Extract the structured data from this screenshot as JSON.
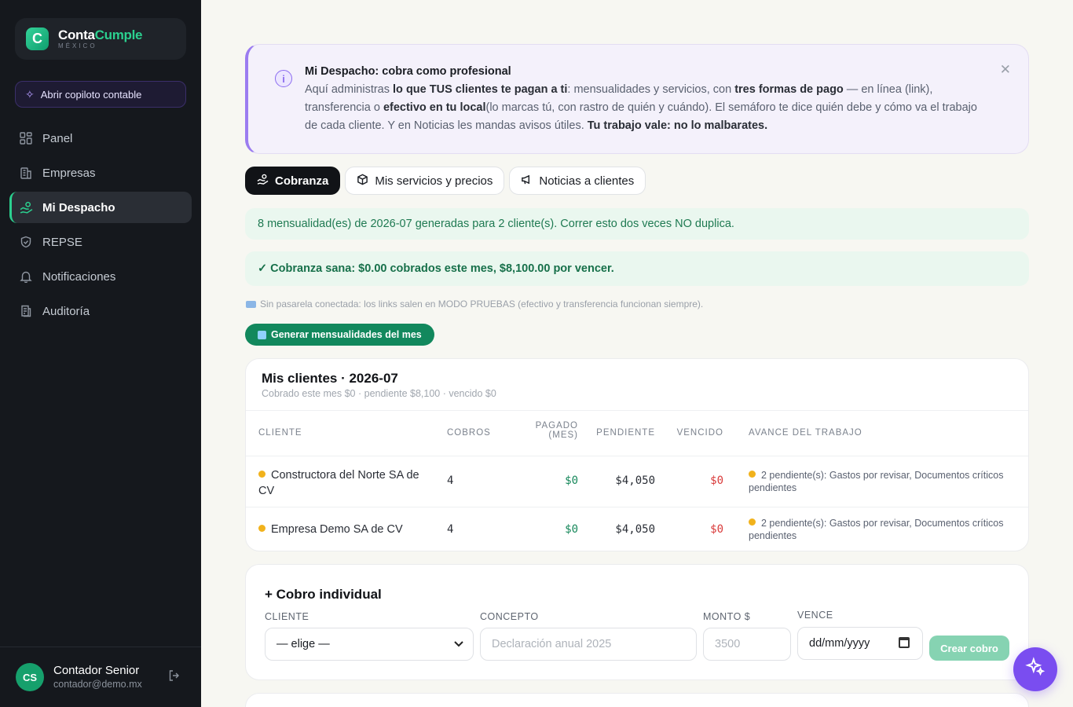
{
  "brand": {
    "name_a": "Conta",
    "name_b": "Cumple",
    "sub": "MÉXICO",
    "logo_letter": "C"
  },
  "copilot": {
    "label": "Abrir copiloto contable",
    "icon": "sparkles-icon"
  },
  "nav": [
    {
      "label": "Panel",
      "icon": "grid-icon"
    },
    {
      "label": "Empresas",
      "icon": "building-icon"
    },
    {
      "label": "Mi Despacho",
      "icon": "hand-coins-icon",
      "active": true
    },
    {
      "label": "REPSE",
      "icon": "shield-icon"
    },
    {
      "label": "Notificaciones",
      "icon": "bell-icon"
    },
    {
      "label": "Auditoría",
      "icon": "receipt-icon"
    }
  ],
  "user": {
    "initials": "CS",
    "name": "Contador Senior",
    "email": "contador@demo.mx"
  },
  "banner": {
    "title": "Mi Despacho: cobra como profesional",
    "p1": "Aquí administras ",
    "b1": "lo que TUS clientes te pagan a ti",
    "p2": ": mensualidades y servicios, con ",
    "b2": "tres formas de pago",
    "p3": " — en línea (link), transferencia o ",
    "b3": "efectivo en tu local",
    "p4": "(lo marcas tú, con rastro de quién y cuándo). El semáforo te dice quién debe y cómo va el trabajo de cada cliente. Y en Noticias les mandas avisos útiles. ",
    "b4": "Tu trabajo vale: no lo malbarates."
  },
  "tabs": [
    {
      "label": "Cobranza",
      "icon": "hand-coins-icon",
      "active": true
    },
    {
      "label": "Mis servicios y precios",
      "icon": "box-icon"
    },
    {
      "label": "Noticias a clientes",
      "icon": "megaphone-icon"
    }
  ],
  "alert1": "8 mensualidad(es) de 2026-07 generadas para 2 cliente(s). Correr esto dos veces NO duplica.",
  "alert2": "✓ Cobranza sana: $0.00 cobrados este mes, $8,100.00 por vencer.",
  "note": "Sin pasarela conectada: los links salen en MODO PRUEBAS (efectivo y transferencia funcionan siempre).",
  "generate_button": "Generar mensualidades del mes",
  "clients": {
    "title": "Mis clientes · 2026-07",
    "subtitle": "Cobrado este mes $0 · pendiente $8,100 · vencido $0",
    "headers": {
      "cliente": "CLIENTE",
      "cobros": "COBROS",
      "pagado_a": "PAGADO",
      "pagado_b": "(MES)",
      "pendiente": "PENDIENTE",
      "vencido": "VENCIDO",
      "avance": "AVANCE DEL TRABAJO"
    },
    "rows": [
      {
        "name": "Constructora del Norte SA de CV",
        "cobros": "4",
        "pagado": "$0",
        "pendiente": "$4,050",
        "vencido": "$0",
        "avance": "2 pendiente(s): Gastos por revisar, Documentos críticos pendientes"
      },
      {
        "name": "Empresa Demo SA de CV",
        "cobros": "4",
        "pagado": "$0",
        "pendiente": "$4,050",
        "vencido": "$0",
        "avance": "2 pendiente(s): Gastos por revisar, Documentos críticos pendientes"
      }
    ]
  },
  "cobro": {
    "title": "+ Cobro individual",
    "cliente_label": "CLIENTE",
    "cliente_value": "— elige —",
    "concepto_label": "CONCEPTO",
    "concepto_placeholder": "Declaración anual 2025",
    "monto_label": "MONTO $",
    "monto_placeholder": "3500",
    "vence_label": "VENCE",
    "vence_value": "dd/mm/yyyy",
    "create_button": "Crear cobro"
  },
  "colors": {
    "accent": "#2bd08f",
    "primary_button": "#12885d",
    "fab": "#7a4df0",
    "warning_dot": "#f1b21c"
  }
}
